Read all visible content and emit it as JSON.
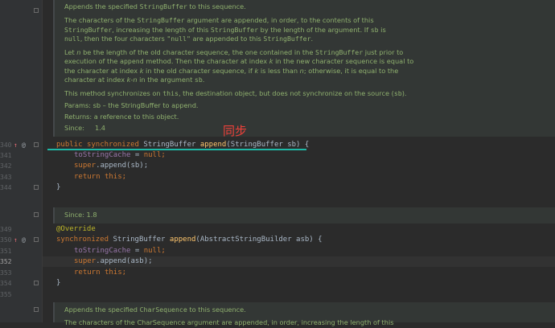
{
  "doc1": {
    "line1_a": "Appends the specified ",
    "line1_code": "StringBuffer",
    "line1_b": " to this sequence.",
    "para1_l1_a": "The characters of the ",
    "para1_l1_code": "StringBuffer",
    "para1_l1_b": " argument are appended, in order, to the contents of this",
    "para1_l2_code": "StringBuffer",
    "para1_l2_a": ", increasing the length of this ",
    "para1_l2_code2": "StringBuffer",
    "para1_l2_b": " by the length of the argument. If ",
    "para1_l2_code3": "sb",
    "para1_l2_c": " is",
    "para1_l3_code": "null",
    "para1_l3_a": ", then the four characters ",
    "para1_l3_code2": "\"null\"",
    "para1_l3_b": " are appended to this ",
    "para1_l3_code3": "StringBuffer",
    "para1_l3_c": ".",
    "para2_l1_a": "Let ",
    "para2_l1_n": "n",
    "para2_l1_b": " be the length of the old character sequence, the one contained in the ",
    "para2_l1_code": "StringBuffer",
    "para2_l1_c": " just prior to",
    "para2_l2_a": "execution of the ",
    "para2_l2_code": "append",
    "para2_l2_b": " method. Then the character at index ",
    "para2_l2_k": "k",
    "para2_l2_c": " in the new character sequence is equal to",
    "para2_l3_a": "the character at index ",
    "para2_l3_k": "k",
    "para2_l3_b": " in the old character sequence, if ",
    "para2_l3_k2": "k",
    "para2_l3_c": " is less than ",
    "para2_l3_n": "n",
    "para2_l3_d": "; otherwise, it is equal to the",
    "para2_l4_a": "character at index ",
    "para2_l4_kn": "k-n",
    "para2_l4_b": " in the argument ",
    "para2_l4_code": "sb",
    "para2_l4_c": ".",
    "para3_a": "This method synchronizes on ",
    "para3_code": "this",
    "para3_b": ", the destination object, but does not synchronize on the source (",
    "para3_code2": "sb",
    "para3_c": ").",
    "params": "Params: sb – the StringBuffer to append.",
    "returns": "Returns: a reference to this object.",
    "since": "Since:     1.4"
  },
  "doc2": {
    "since": "Since: 1.8"
  },
  "doc3": {
    "line1_a": "Appends the specified ",
    "line1_code": "CharSequence",
    "line1_b": " to this sequence.",
    "line2": "The characters of the CharSequence argument are appended, in order, increasing the length of this"
  },
  "gutter": {
    "l340": "340",
    "l341": "341",
    "l342": "342",
    "l343": "343",
    "l344": "344",
    "l349": "349",
    "l350": "350",
    "l351": "351",
    "l352": "352",
    "l353": "353",
    "l354": "354",
    "l355": "355",
    "override_marker": "↑",
    "at_marker": "@"
  },
  "code": {
    "m1_public": "public",
    "m1_sync": "synchronized",
    "m1_type": "StringBuffer",
    "m1_name": "append",
    "m1_params": "(StringBuffer sb) {",
    "m1_l1_field": "toStringCache",
    "m1_l1_rest": " = ",
    "m1_l1_null": "null",
    "m1_l1_end": ";",
    "m1_l2_super": "super",
    "m1_l2_rest": ".append(sb);",
    "m1_l3_return": "return",
    "m1_l3_this": "this",
    "m1_l3_end": ";",
    "m1_close": "}",
    "m2_annotation": "@Override",
    "m2_sync": "synchronized",
    "m2_type": "StringBuffer",
    "m2_name": "append",
    "m2_params": "(AbstractStringBuilder asb) {",
    "m2_l1_field": "toStringCache",
    "m2_l1_rest": " = ",
    "m2_l1_null": "null",
    "m2_l1_end": ";",
    "m2_l2_super": "super",
    "m2_l2_rest": ".append(asb);",
    "m2_l3_return": "return",
    "m2_l3_this": "this",
    "m2_l3_end": ";",
    "m2_close": "}"
  },
  "overlay": {
    "label": "同步"
  },
  "colors": {
    "editor_bg": "#2b2b2b",
    "keyword": "#cc7832",
    "method": "#ffc66d",
    "field": "#9876aa",
    "doc_text": "#8fb06e",
    "underline": "#1eb8a6",
    "overlay_label": "#f0413a"
  }
}
